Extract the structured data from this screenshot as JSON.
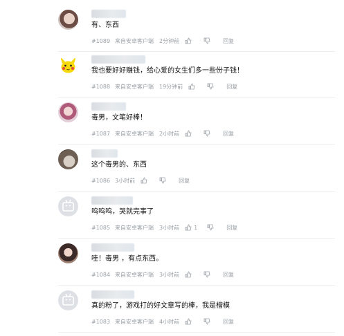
{
  "comments": [
    {
      "avatar": "avatar-photo",
      "text": "有、东西",
      "floor": "#1089",
      "source": "来自安卓客户端",
      "time": "2分钟前",
      "like_count": "",
      "reply_label": "回复"
    },
    {
      "avatar": "pikachu-avatar",
      "text": "我也要好好赚钱，给心爱的女生们多一些份子钱！",
      "floor": "#1088",
      "source": "来自安卓客户端",
      "time": "19分钟前",
      "like_count": "",
      "reply_label": "回复"
    },
    {
      "avatar": "avatar-photo",
      "text": "毒男，文笔好棒！",
      "floor": "#1087",
      "source": "来自安卓客户端",
      "time": "2小时前",
      "like_count": "",
      "reply_label": "回复"
    },
    {
      "avatar": "cat-avatar",
      "text": "这个毒男的、东西",
      "floor": "#1086",
      "source": "",
      "time": "3小时前",
      "like_count": "",
      "reply_label": "回复"
    },
    {
      "avatar": "default-tv-avatar",
      "text": "呜呜呜，哭就完事了",
      "floor": "#1085",
      "source": "来自安卓客户端",
      "time": "3小时前",
      "like_count": "1",
      "reply_label": "回复"
    },
    {
      "avatar": "avatar-photo",
      "text": "哇！毒男 ，有点东西。",
      "floor": "#1084",
      "source": "来自安卓客户端",
      "time": "3小时前",
      "like_count": "",
      "reply_label": "回复"
    },
    {
      "avatar": "default-tv-avatar",
      "text": "真的粉了，游戏打的好文章写的棒，我是楷模",
      "floor": "#1083",
      "source": "来自安卓客户端",
      "time": "4小时前",
      "like_count": "",
      "reply_label": "回复"
    }
  ],
  "colors": {
    "meta": "#9aa0a6",
    "text": "#111111",
    "divider": "#ececec"
  }
}
